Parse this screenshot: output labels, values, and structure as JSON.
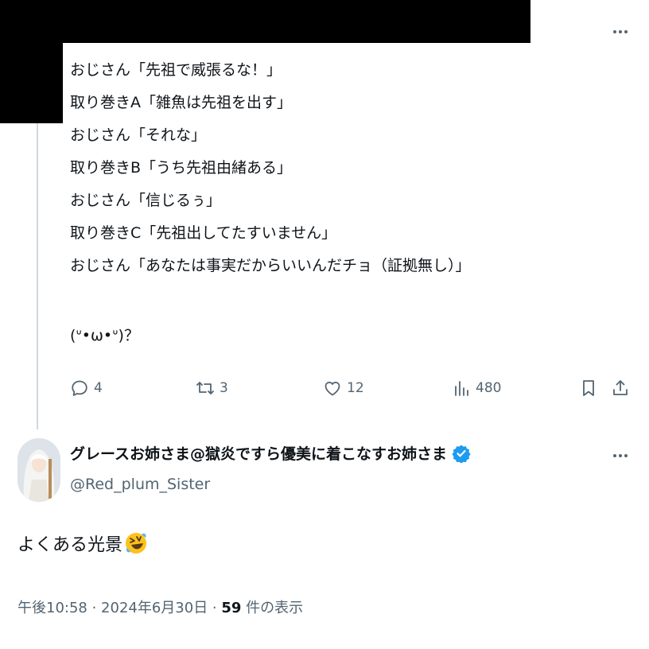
{
  "tweet": {
    "lines": [
      "おじさん「先祖で威張るな！」",
      "取り巻きA「雑魚は先祖を出す」",
      "おじさん「それな」",
      "取り巻きB「うち先祖由緒ある」",
      "おじさん「信じるぅ」",
      "取り巻きC「先祖出してたすいません」",
      "おじさん「あなたは事実だからいいんだチョ（証拠無し）」"
    ],
    "kaomoji": "(ᐡ•ω•ᐡ)？",
    "stats": {
      "replies": "4",
      "retweets": "3",
      "likes": "12",
      "views": "480"
    },
    "icons": [
      "reply-icon",
      "retweet-icon",
      "like-icon",
      "views-icon",
      "bookmark-icon",
      "share-icon",
      "more-icon"
    ]
  },
  "reply": {
    "display_name": "グレースお姉さま@獄炎ですら優美に着こなすお姉さま",
    "handle": "@Red_plum_Sister",
    "text": "よくある光景",
    "emoji": "rolling-laughing-emoji",
    "timestamp": "午後10:58 · 2024年6月30日 · ",
    "view_count": "59",
    "view_suffix": " 件の表示",
    "verified_color": "#1d9bf0"
  },
  "colors": {
    "text": "#0f1419",
    "secondary": "#536471",
    "thread_line": "#cfd9de",
    "redaction": "#000000"
  }
}
